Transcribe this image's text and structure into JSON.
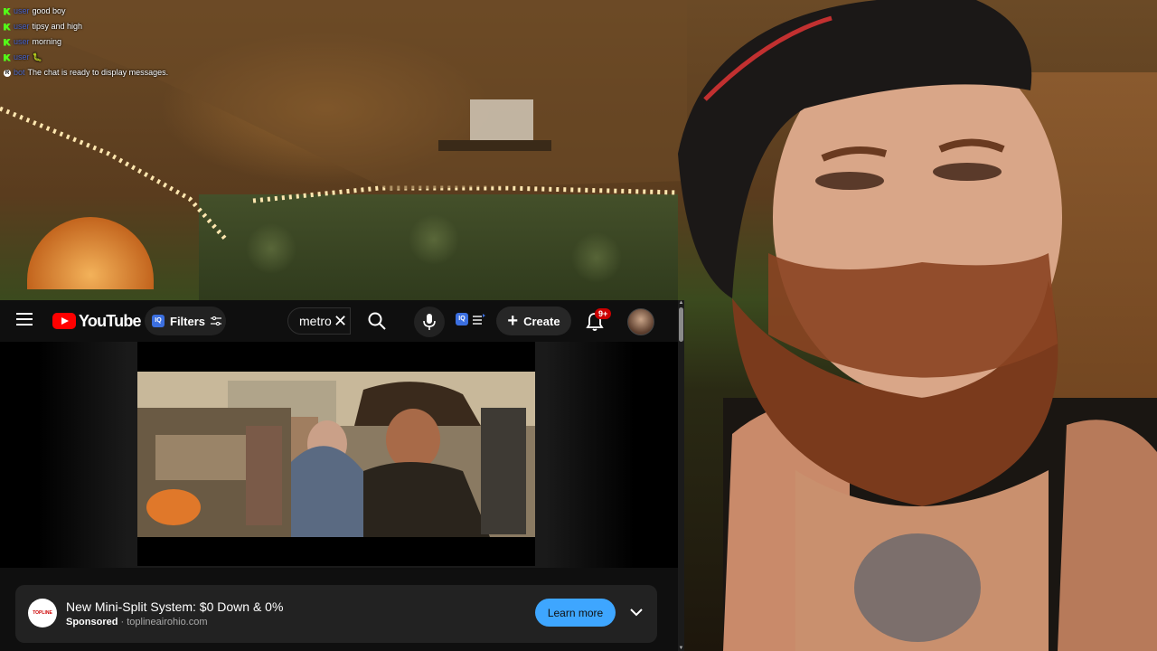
{
  "chat": {
    "messages": [
      {
        "badge": "kick",
        "user": "user",
        "text": "good boy"
      },
      {
        "badge": "kick",
        "user": "user",
        "text": "tipsy and high"
      },
      {
        "badge": "kick",
        "user": "user",
        "text": "morning"
      },
      {
        "badge": "kick",
        "user": "user",
        "text": "🐛"
      },
      {
        "badge": "r",
        "user": "bot",
        "text": "The chat is ready to display messages."
      }
    ]
  },
  "youtube": {
    "logo_text": "YouTube",
    "filters_label": "Filters",
    "iq_badge": "IQ",
    "search_value": "metro",
    "create_label": "Create",
    "notification_count": "9+"
  },
  "ad": {
    "title": "New Mini-Split System: $0 Down & 0%",
    "sponsored": "Sponsored",
    "separator": "·",
    "domain": "toplineairohio.com",
    "logo_text": "TOPLINE",
    "cta": "Learn more"
  },
  "colors": {
    "youtube_red": "#ff0000",
    "cta_blue": "#3ea6ff",
    "kick_green": "#53fc18",
    "notification_red": "#cc0000"
  }
}
